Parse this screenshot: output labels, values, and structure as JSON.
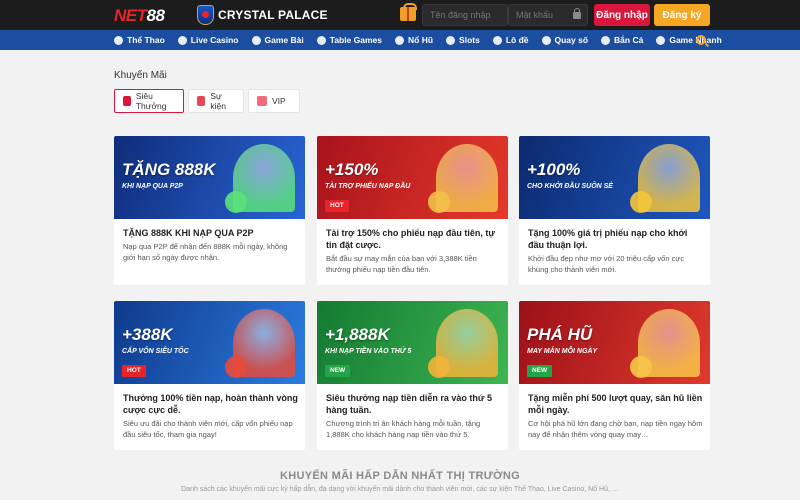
{
  "header": {
    "logo_text_red": "NET",
    "logo_text_white": "88",
    "partner": "CRYSTAL PALACE",
    "username_placeholder": "Tên đăng nhập",
    "password_placeholder": "Mật khẩu",
    "login_label": "Đăng nhập",
    "register_label": "Đăng ký"
  },
  "nav": {
    "items": [
      {
        "label": "Thể Thao",
        "icon": "ball-icon"
      },
      {
        "label": "Live Casino",
        "icon": "casino-icon"
      },
      {
        "label": "Game Bài",
        "icon": "cards-icon"
      },
      {
        "label": "Table Games",
        "icon": "table-icon"
      },
      {
        "label": "Nổ Hũ",
        "icon": "slot-icon"
      },
      {
        "label": "Slots",
        "icon": "slots-icon"
      },
      {
        "label": "Lô đề",
        "icon": "lottery-icon"
      },
      {
        "label": "Quay số",
        "icon": "spin-icon"
      },
      {
        "label": "Bắn Cá",
        "icon": "fish-icon"
      },
      {
        "label": "Game Nhanh",
        "icon": "fast-game-icon"
      }
    ]
  },
  "section": {
    "title": "Khuyến Mãi",
    "filters": [
      {
        "label": "Siêu Thưởng",
        "active": true
      },
      {
        "label": "Sự kiện",
        "active": false
      },
      {
        "label": "VIP",
        "active": false
      }
    ]
  },
  "cards": [
    {
      "banner_big": "TẶNG 888K",
      "banner_sub": "KHI NẠP QUA P2P",
      "badge": "",
      "colors": [
        "#0f2d7a",
        "#2a64d6"
      ],
      "deco": "#5be27a",
      "title": "TẶNG 888K KHI NẠP QUA P2P",
      "desc": "Nạp qua P2P để nhận đến 888K mỗi ngày, không giới hạn số ngày được nhận."
    },
    {
      "banner_big": "+150%",
      "banner_sub": "TÀI TRỢ PHIẾU NẠP ĐẦU",
      "badge": "HOT",
      "colors": [
        "#a8121c",
        "#e5392b"
      ],
      "deco": "#f2c04a",
      "title": "Tài trợ 150% cho phiếu nạp đầu tiên, tự tin đặt cược.",
      "desc": "Bắt đầu sự may mắn của bạn với 3,388K tiền thưởng phiếu nạp tiền đầu tiên."
    },
    {
      "banner_big": "+100%",
      "banner_sub": "CHO KHỞI ĐẦU SUÔN SẺ",
      "badge": "",
      "colors": [
        "#0c2a6e",
        "#1f57c0"
      ],
      "deco": "#f3c53a",
      "title": "Tặng 100% giá trị phiếu nạp cho khởi đầu thuận lợi.",
      "desc": "Khởi đầu đẹp như mơ với 20 triệu cấp vốn cực khủng cho thành viên mới."
    },
    {
      "banner_big": "+388K",
      "banner_sub": "CẤP VỐN SIÊU TỐC",
      "badge": "HOT",
      "colors": [
        "#0e3a8c",
        "#2c7be0"
      ],
      "deco": "#e84a3a",
      "title": "Thưởng 100% tiền nạp, hoàn thành vòng cược cực dễ.",
      "desc": "Siêu ưu đãi cho thành viên mới, cấp vốn phiếu nạp đầu siêu tốc, tham gia ngay!"
    },
    {
      "banner_big": "+1,888K",
      "banner_sub": "KHI NẠP TIỀN VÀO THỨ 5",
      "badge": "NEW",
      "colors": [
        "#137a32",
        "#3fb552"
      ],
      "deco": "#f2b33a",
      "title": "Siêu thưởng nạp tiền diễn ra vào thứ 5 hàng tuần.",
      "desc": "Chương trình tri ân khách hàng mỗi tuần, tặng 1,888K cho khách hàng nạp tiền vào thứ 5."
    },
    {
      "banner_big": "PHÁ HŨ",
      "banner_sub": "MAY MẮN MỖI NGÀY",
      "badge": "NEW",
      "colors": [
        "#9c1019",
        "#e03a2c"
      ],
      "deco": "#f7c64a",
      "title": "Tặng miễn phí 500 lượt quay, săn hũ liền mỗi ngày.",
      "desc": "Cơ hội phá hũ lớn đang chờ bạn, nạp tiền ngay hôm nay để nhận thêm vòng quay may…"
    }
  ],
  "footer": {
    "title": "KHUYẾN MÃI HẤP DẪN NHẤT THỊ TRƯỜNG",
    "desc": "Danh sách các khuyến mãi cực kỳ hấp dẫn, đa dạng với khuyến mãi dành cho thành viên mới, các sự kiện Thể Thao, Live Casino, Nổ Hũ, …"
  }
}
